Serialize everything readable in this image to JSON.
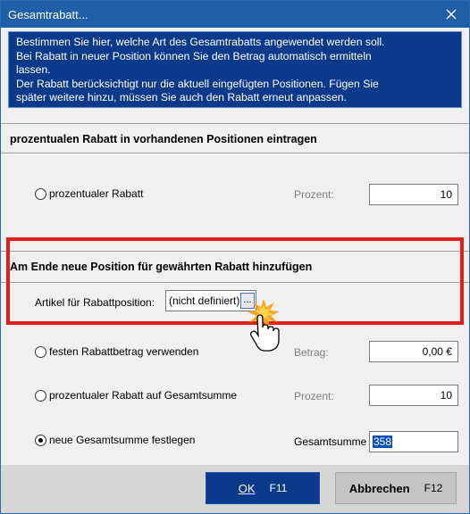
{
  "window": {
    "title": "Gesamtrabatt...",
    "close_glyph": "✕"
  },
  "info": {
    "lines": [
      "Bestimmen Sie hier, welche Art des Gesamtrabatts angewendet werden soll.",
      "Bei Rabatt in neuer Position können Sie den Betrag automatisch ermitteln",
      "lassen.",
      "Der Rabatt berücksichtigt nur die aktuell eingefügten Positionen. Fügen Sie",
      "später weitere hinzu, müssen Sie auch den Rabatt erneut anpassen."
    ]
  },
  "section1": {
    "title": "prozentualen Rabatt in vorhandenen Positionen eintragen",
    "option_label": "prozentualer Rabatt",
    "field_label": "Prozent:",
    "field_value": "10"
  },
  "section2": {
    "title": "Am Ende neue Position für gewährten Rabatt hinzufügen",
    "article_label": "Artikel für Rabattposition:",
    "article_value": "(nicht definiert)",
    "article_button": "...",
    "options": [
      {
        "label": "festen Rabattbetrag verwenden",
        "field_label": "Betrag:",
        "field_value": "0,00 €",
        "checked": false
      },
      {
        "label": "prozentualer Rabatt auf Gesamtsumme",
        "field_label": "Prozent:",
        "field_value": "10",
        "checked": false
      },
      {
        "label": "neue Gesamtsumme festlegen",
        "field_label": "Gesamtsumme",
        "field_value": "358",
        "checked": true
      }
    ]
  },
  "buttons": {
    "ok_label": "OK",
    "ok_key": "F11",
    "cancel_label": "Abbrechen",
    "cancel_key": "F12"
  },
  "colors": {
    "titlebar": "#1f5fa8",
    "info_bg": "#0b3a8c",
    "highlight": "#e51c1c",
    "ok_bg": "#0b3a8c"
  },
  "icons": {
    "cursor": "hand-pointer-icon"
  }
}
